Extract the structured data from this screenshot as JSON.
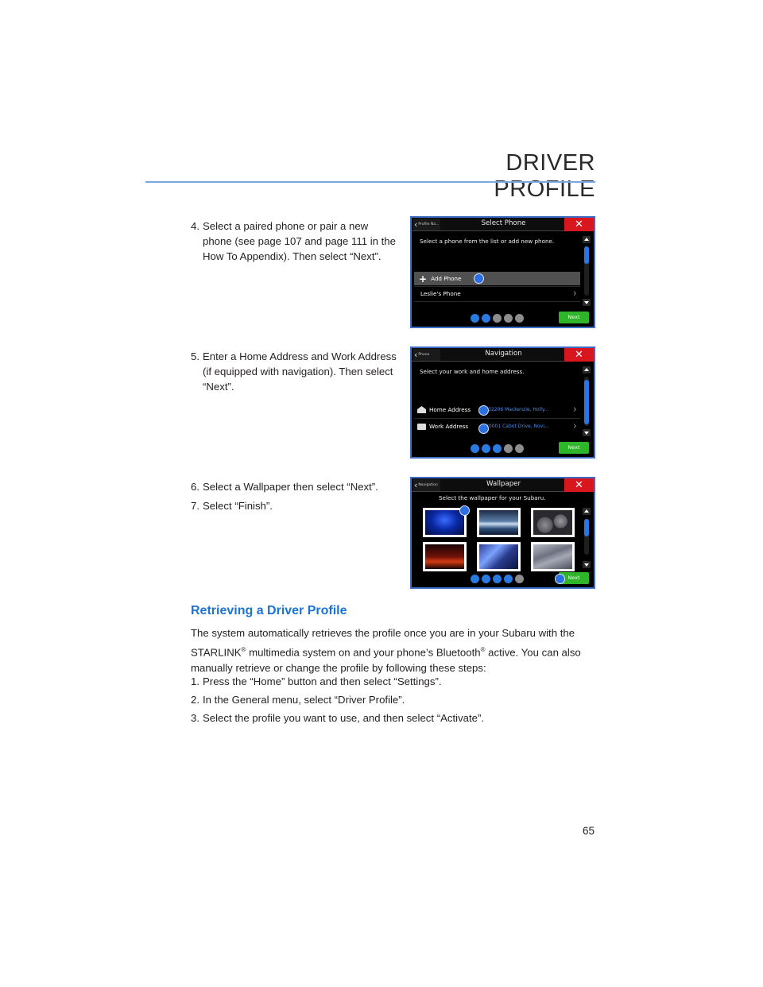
{
  "header": {
    "section_title": "DRIVER PROFILE",
    "rule_color": "#7aa8e6"
  },
  "steps_top": [
    {
      "num": "4.",
      "text": "Select a paired phone or pair a new phone (see page 107 and page 111 in the How To Appendix). Then select “Next”."
    },
    {
      "num": "5.",
      "text": "Enter a Home Address and Work Address (if equipped with navigation). Then select “Next”."
    },
    {
      "num": "6.",
      "text": "Select a Wallpaper then select “Next”."
    },
    {
      "num": "7.",
      "text": "Select “Finish”."
    }
  ],
  "screens": {
    "phone": {
      "back_label": "Profile Na...",
      "title": "Select Phone",
      "prompt": "Select a phone from the list or add new phone.",
      "items": [
        "Add Phone",
        "Leslie's Phone"
      ],
      "next_label": "Next",
      "progress_step": 2,
      "progress_total": 5
    },
    "navigation": {
      "back_label": "Phone",
      "title": "Navigation",
      "prompt": "Select your work and home address.",
      "home_label": "Home Address",
      "home_value": "32206 Mackenzie, Holly...",
      "work_label": "Work Address",
      "work_value": "30001 Cabot Drive, Novi...",
      "next_label": "Next",
      "progress_step": 3,
      "progress_total": 5
    },
    "wallpaper": {
      "back_label": "Navigation",
      "title": "Wallpaper",
      "prompt": "Select the wallpaper for your Subaru.",
      "thumbnails": [
        "blue-starfield",
        "ocean-wave",
        "stones",
        "red-horizon",
        "aurora",
        "silver-streaks"
      ],
      "next_label": "Next",
      "progress_step": 4,
      "progress_total": 5
    },
    "close_icon": "close-icon",
    "accent_blue": "#2b7ae0",
    "close_red": "#d7161d",
    "next_green": "#2fb52a"
  },
  "retrieve": {
    "heading": "Retrieving a Driver Profile",
    "heading_color": "#1b73d6",
    "intro_1": "The system automatically retrieves the profile once you are in your Subaru with the STARLINK",
    "reg1": "®",
    "intro_2": " multimedia system on and your phone’s Bluetooth",
    "reg2": "®",
    "intro_3": " active. You can also manually retrieve or change the profile by following these steps:",
    "steps": [
      {
        "num": "1.",
        "text": "Press the “Home” button and then select “Settings”."
      },
      {
        "num": "2.",
        "text": "In the General menu, select “Driver Profile”."
      },
      {
        "num": "3.",
        "text": "Select the profile you want to use, and then select “Activate”."
      }
    ]
  },
  "footer": {
    "page_number": "65"
  }
}
